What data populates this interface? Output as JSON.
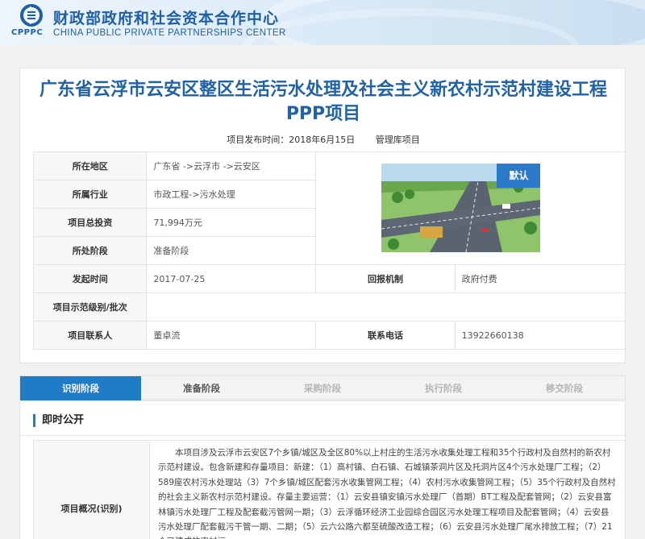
{
  "header": {
    "logo_abbr": "CPPPC",
    "org_name_cn": "财政部政府和社会资本合作中心",
    "org_name_en": "CHINA PUBLIC PRIVATE PARTNERSHIPS CENTER"
  },
  "project": {
    "title": "广东省云浮市云安区整区生活污水处理及社会主义新农村示范村建设工程PPP项目",
    "publish_label": "项目发布时间：2018年6月15日",
    "status_label": "管理库项目",
    "image_badge": "默认"
  },
  "info": {
    "region_label": "所在地区",
    "region_value": "广东省 ->云浮市 ->云安区",
    "industry_label": "所属行业",
    "industry_value": "市政工程->污水处理",
    "investment_label": "项目总投资",
    "investment_value": "71,994万元",
    "stage_label": "所处阶段",
    "stage_value": "准备阶段",
    "start_label": "发起时间",
    "start_value": "2017-07-25",
    "return_label": "回报机制",
    "return_value": "政府付费",
    "demo_label": "项目示范级别/批次",
    "demo_value": "",
    "contact_label": "项目联系人",
    "contact_value": "董卓流",
    "phone_label": "联系电话",
    "phone_value": "13922660138"
  },
  "tabs": [
    {
      "label": "识别阶段",
      "active": true
    },
    {
      "label": "准备阶段",
      "active": false
    },
    {
      "label": "采购阶段",
      "active": false
    },
    {
      "label": "执行阶段",
      "active": false
    },
    {
      "label": "移交阶段",
      "active": false
    }
  ],
  "disclosure": {
    "section_title": "即时公开",
    "overview_label": "项目概况(识别)",
    "overview_text": "本项目涉及云浮市云安区7个乡镇/城区及全区80%以上村庄的生活污水收集处理工程和35个行政村及自然村的新农村示范村建设。包含新建和存量项目：新建：（1）高村镇、白石镇、石城镇茶洞片区及托洞片区4个污水处理厂工程；（2）589座农村污水处理站（3）7个乡镇/城区配套污水收集管网工程；（4）农村污水收集管网工程；（5）35个行政村及自然村的社会主义新农村示范村建设。存量主要运营：（1）云安县镇安镇污水处理厂（首期）BT工程及配套管网；（2）云安县富林镇污水处理厂工程及配套截污管网一期；（3）云浮循环经济工业园综合园区污水处理工程项目及配套管网；（4）云安县污水处理厂配套截污干管一期、二期；（5）云六公路六都至硫酸改造工程；（6）云安县污水处理厂尾水排放工程；（7）21个已建成的农村污"
  },
  "colors": {
    "brand": "#1f62a8",
    "tab_active": "#1f7cc7"
  },
  "icons": {
    "logo": "cpppc-logo-icon",
    "photo": "project-photo"
  }
}
